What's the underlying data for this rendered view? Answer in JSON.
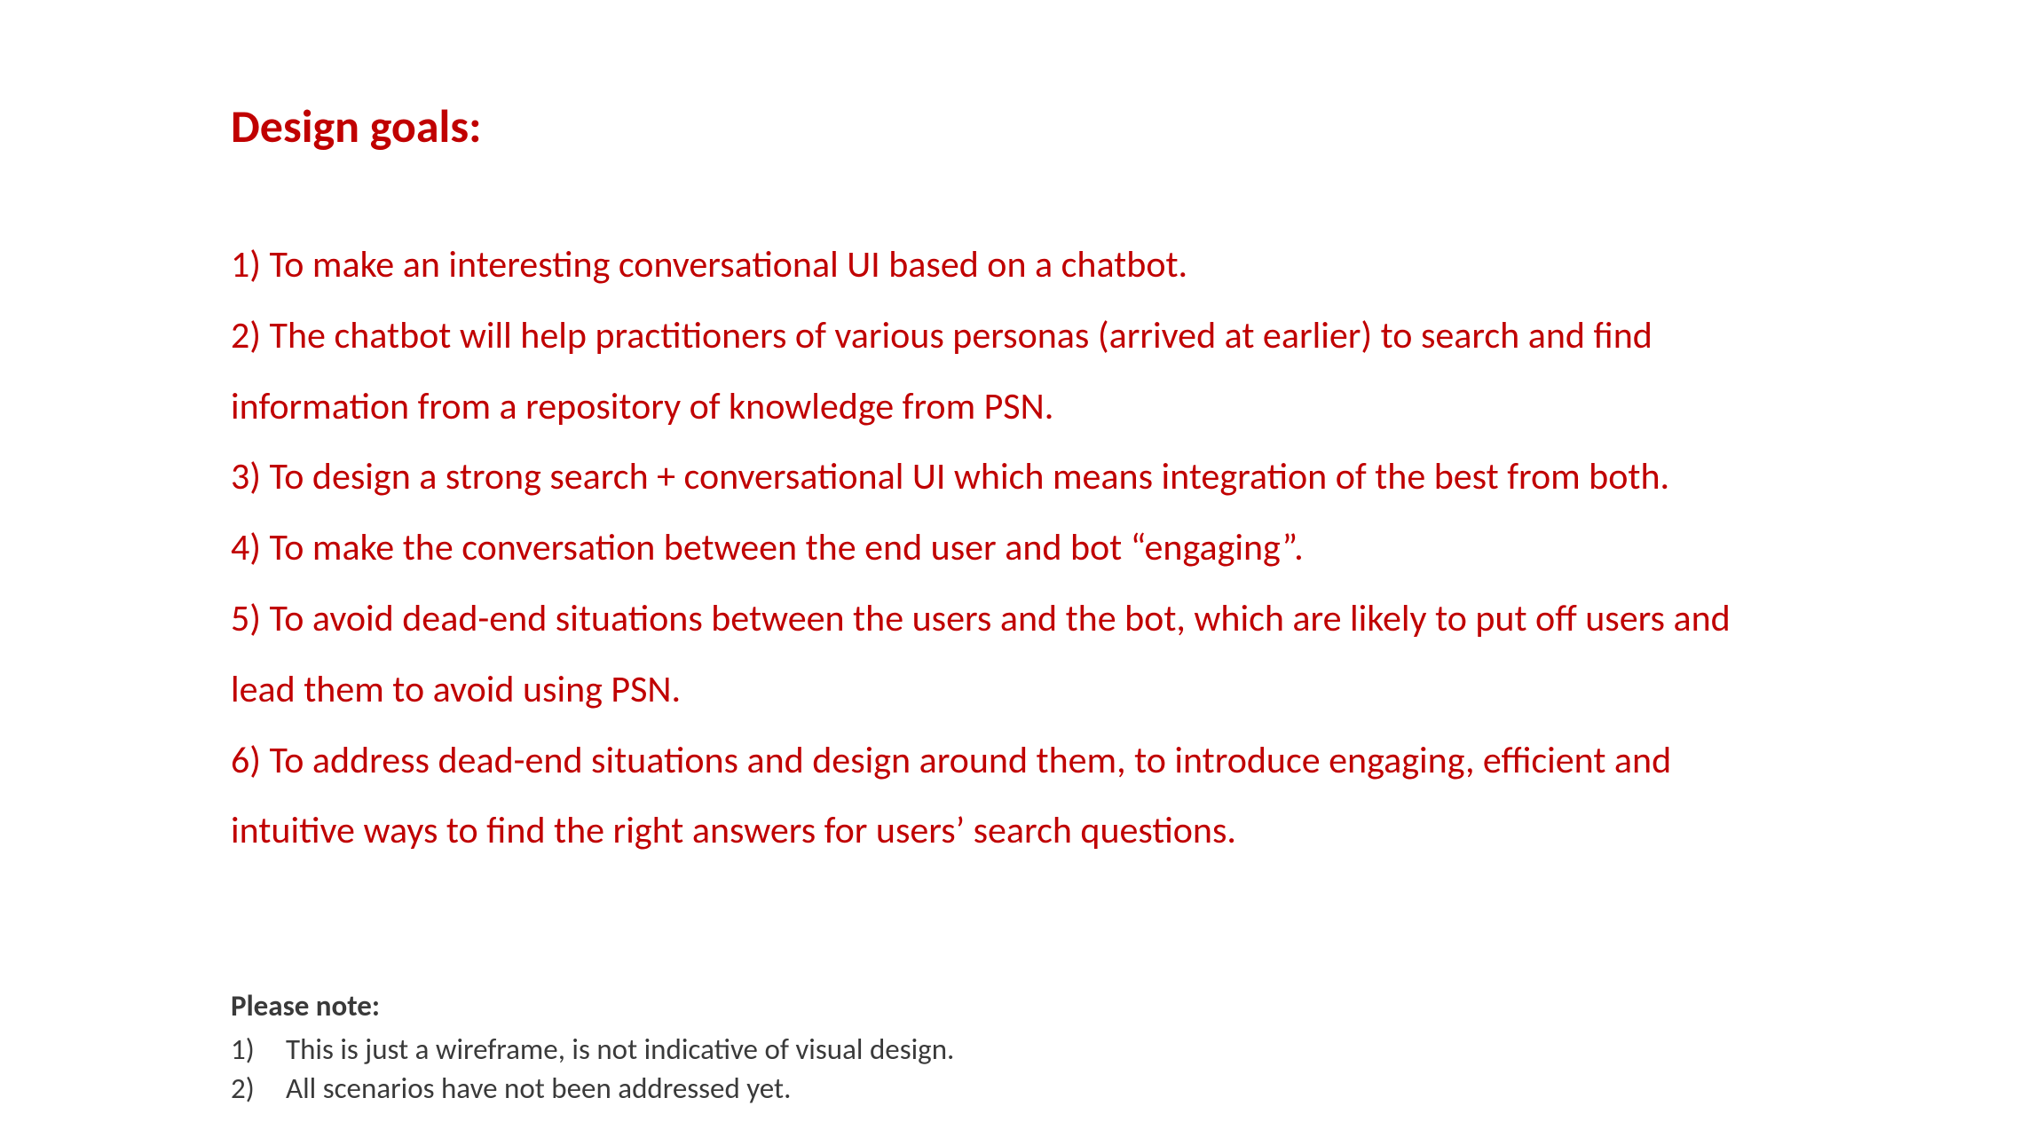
{
  "heading": "Design goals:",
  "goals": [
    "1) To make an interesting conversational UI based on a chatbot.",
    "2) The chatbot will help practitioners of various personas (arrived at earlier) to search and find information from a repository of knowledge from PSN.",
    "3) To design a strong search + conversational UI which means integration of the best from both.",
    "4) To make the conversation between the end user and bot “engaging”.",
    "5) To avoid dead-end situations between the users and the bot, which are likely to put off users and lead them to avoid using PSN.",
    "6) To address dead-end situations and design around them, to introduce engaging, efficient and intuitive ways to find the right answers for users’ search questions."
  ],
  "notes": {
    "heading": "Please note:",
    "items": [
      {
        "number": "1)",
        "text": "This is just a wireframe, is not indicative of visual design."
      },
      {
        "number": "2)",
        "text": "All scenarios have not been addressed yet."
      }
    ]
  }
}
